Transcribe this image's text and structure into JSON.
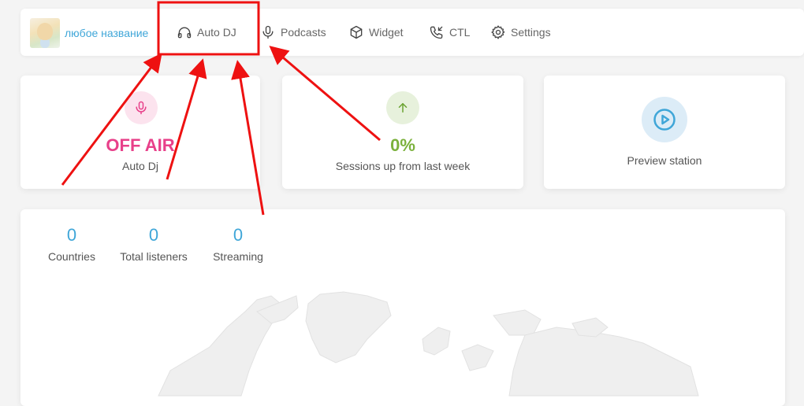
{
  "header": {
    "brand_name": "любое название",
    "nav": [
      {
        "label": "Auto DJ",
        "icon": "headphones-icon"
      },
      {
        "label": "Podcasts",
        "icon": "microphone-icon"
      },
      {
        "label": "Widget",
        "icon": "cube-icon"
      },
      {
        "label": "CTL",
        "icon": "phone-incoming-icon"
      },
      {
        "label": "Settings",
        "icon": "gear-icon"
      }
    ]
  },
  "cards": {
    "status": {
      "value": "OFF AIR",
      "label": "Auto Dj",
      "icon": "microphone-icon",
      "color": "#e8408a"
    },
    "sessions": {
      "value": "0%",
      "label": "Sessions up from last week",
      "icon": "arrow-up-icon",
      "color": "#7bb13c"
    },
    "preview": {
      "label": "Preview station",
      "icon": "play-circle-icon",
      "color": "#3fa6d8"
    }
  },
  "stats": [
    {
      "value": "0",
      "label": "Countries"
    },
    {
      "value": "0",
      "label": "Total listeners"
    },
    {
      "value": "0",
      "label": "Streaming"
    }
  ],
  "colors": {
    "accent": "#3fa6d8",
    "annotation": "#ee1111"
  }
}
